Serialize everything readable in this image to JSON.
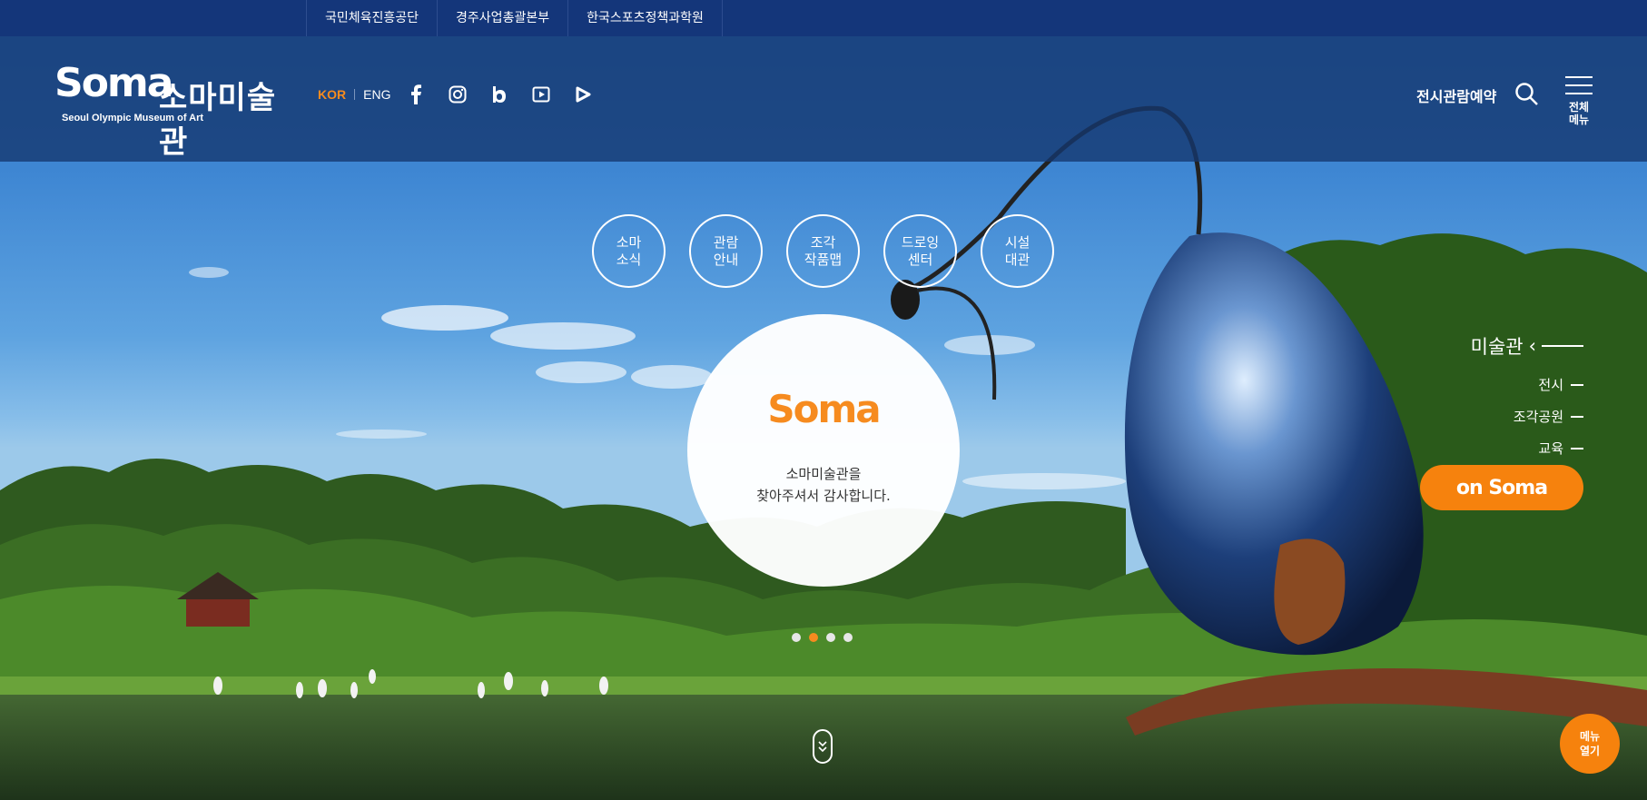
{
  "topbar": {
    "links": [
      "국민체육진흥공단",
      "경주사업총괄본부",
      "한국스포츠정책과학원"
    ]
  },
  "header": {
    "logo": {
      "brand": "Soma",
      "brand_ko": "소마미술관",
      "subtitle": "Seoul Olympic Museum of Art"
    },
    "lang": {
      "kor": "KOR",
      "eng": "ENG"
    },
    "social_icons": [
      "facebook-icon",
      "instagram-icon",
      "blog-icon",
      "youtube-icon",
      "play-icon"
    ],
    "reserve_label": "전시관람예약",
    "menu_all_label_1": "전체",
    "menu_all_label_2": "메뉴"
  },
  "circle_nav": [
    {
      "line1": "소마",
      "line2": "소식"
    },
    {
      "line1": "관람",
      "line2": "안내"
    },
    {
      "line1": "조각",
      "line2": "작품맵"
    },
    {
      "line1": "드로잉",
      "line2": "센터"
    },
    {
      "line1": "시설",
      "line2": "대관"
    }
  ],
  "welcome": {
    "logo": "Soma",
    "line1": "소마미술관을",
    "line2": "찾아주셔서 감사합니다."
  },
  "slider": {
    "total": 4,
    "active_index": 1
  },
  "side_nav": {
    "title": "미술관",
    "items": [
      "전시",
      "조각공원",
      "교육"
    ],
    "onsoma_label": "on Soma"
  },
  "menu_open": {
    "line1": "메뉴",
    "line2": "열기"
  },
  "colors": {
    "accent": "#f68b1f",
    "topbar": "#14367a",
    "header": "#1b3a6e"
  }
}
